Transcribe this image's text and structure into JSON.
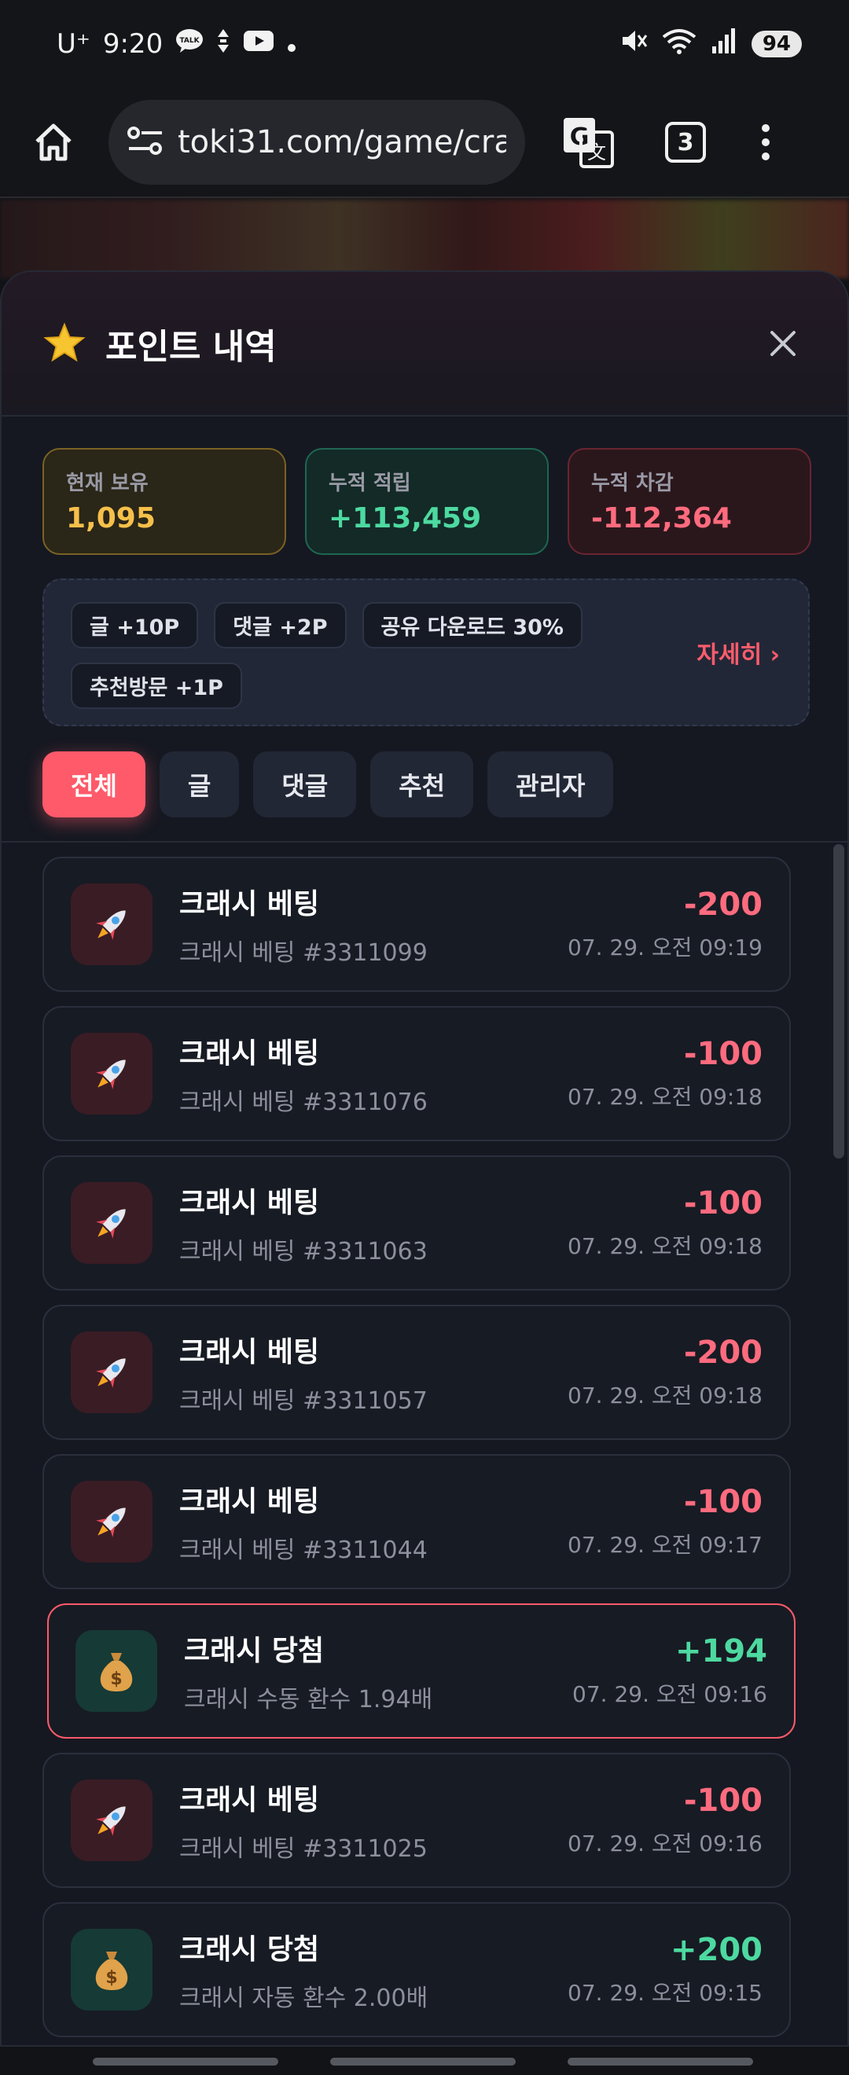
{
  "status_bar": {
    "carrier": "U⁺",
    "time": "9:20",
    "battery": "94"
  },
  "browser": {
    "url": "toki31.com/game/cra",
    "tab_count": "3"
  },
  "modal": {
    "title": "포인트 내역",
    "stats": [
      {
        "label": "현재 보유",
        "value": "1,095"
      },
      {
        "label": "누적 적립",
        "value": "+113,459"
      },
      {
        "label": "누적 차감",
        "value": "-112,364"
      }
    ],
    "rules": [
      "글 +10P",
      "댓글 +2P",
      "공유 다운로드 30%",
      "추천방문 +1P"
    ],
    "details_link": "자세히 ›",
    "filters": [
      "전체",
      "글",
      "댓글",
      "추천",
      "관리자"
    ],
    "active_filter": "전체",
    "entries": [
      {
        "type": "bet",
        "title": "크래시 베팅",
        "sub": "크래시 베팅 #3311099",
        "amount": "-200",
        "time": "07. 29. 오전 09:19"
      },
      {
        "type": "bet",
        "title": "크래시 베팅",
        "sub": "크래시 베팅 #3311076",
        "amount": "-100",
        "time": "07. 29. 오전 09:18"
      },
      {
        "type": "bet",
        "title": "크래시 베팅",
        "sub": "크래시 베팅 #3311063",
        "amount": "-100",
        "time": "07. 29. 오전 09:18"
      },
      {
        "type": "bet",
        "title": "크래시 베팅",
        "sub": "크래시 베팅 #3311057",
        "amount": "-200",
        "time": "07. 29. 오전 09:18"
      },
      {
        "type": "bet",
        "title": "크래시 베팅",
        "sub": "크래시 베팅 #3311044",
        "amount": "-100",
        "time": "07. 29. 오전 09:17"
      },
      {
        "type": "win",
        "title": "크래시 당첨",
        "sub": "크래시 수동 환수 1.94배",
        "amount": "+194",
        "time": "07. 29. 오전 09:16"
      },
      {
        "type": "bet",
        "title": "크래시 베팅",
        "sub": "크래시 베팅 #3311025",
        "amount": "-100",
        "time": "07. 29. 오전 09:16"
      },
      {
        "type": "win",
        "title": "크래시 당첨",
        "sub": "크래시 자동 환수 2.00배",
        "amount": "+200",
        "time": "07. 29. 오전 09:15"
      }
    ]
  },
  "colors": {
    "accent": "#ff5a6a",
    "positive": "#4dd9a0",
    "negative": "#ff6b7e",
    "gold": "#f5c04a"
  },
  "icons": {
    "bet": "rocket-icon",
    "win": "money-bag-icon"
  }
}
